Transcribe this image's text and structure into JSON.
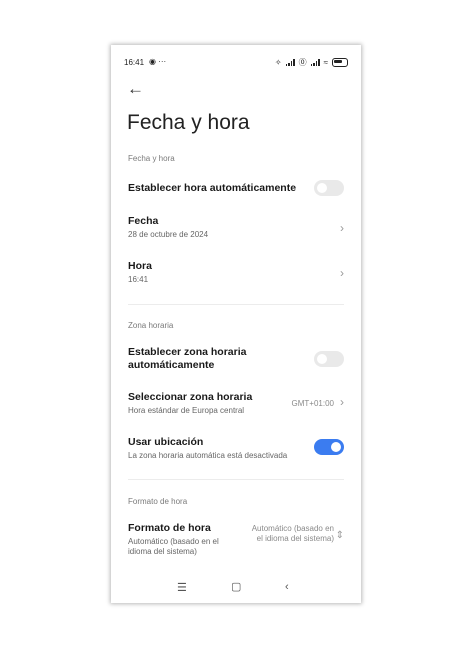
{
  "status_bar": {
    "time": "16:41",
    "left_icons": "⚙ ···",
    "right_icons": [
      "vibrate-icon",
      "signal-icon",
      "ring-icon",
      "signal-icon",
      "wifi-icon",
      "battery-icon"
    ]
  },
  "header": {
    "back_icon": "back-arrow-icon",
    "title": "Fecha y hora"
  },
  "sections": {
    "date_time_label": "Fecha y hora",
    "timezone_label": "Zona horaria",
    "format_label": "Formato de hora"
  },
  "rows": {
    "auto_time": {
      "title": "Establecer hora automáticamente",
      "toggle_on": false
    },
    "date": {
      "title": "Fecha",
      "subtitle": "28 de octubre de 2024"
    },
    "time": {
      "title": "Hora",
      "subtitle": "16:41"
    },
    "auto_timezone": {
      "title": "Establecer zona horaria automáticamente",
      "toggle_on": false
    },
    "select_timezone": {
      "title": "Seleccionar zona horaria",
      "subtitle": "Hora estándar de Europa central",
      "value": "GMT+01:00"
    },
    "use_location": {
      "title": "Usar ubicación",
      "subtitle": "La zona horaria automática está desactivada",
      "toggle_on": true
    },
    "time_format": {
      "title": "Formato de hora",
      "subtitle": "Automático (basado en el idioma del sistema)",
      "value": "Automático (basado en el idioma del sistema)"
    }
  },
  "colors": {
    "accent": "#3b7cf0",
    "toggle_off": "#e9e9e9"
  },
  "nav": [
    "menu-icon",
    "home-icon",
    "back-icon"
  ]
}
